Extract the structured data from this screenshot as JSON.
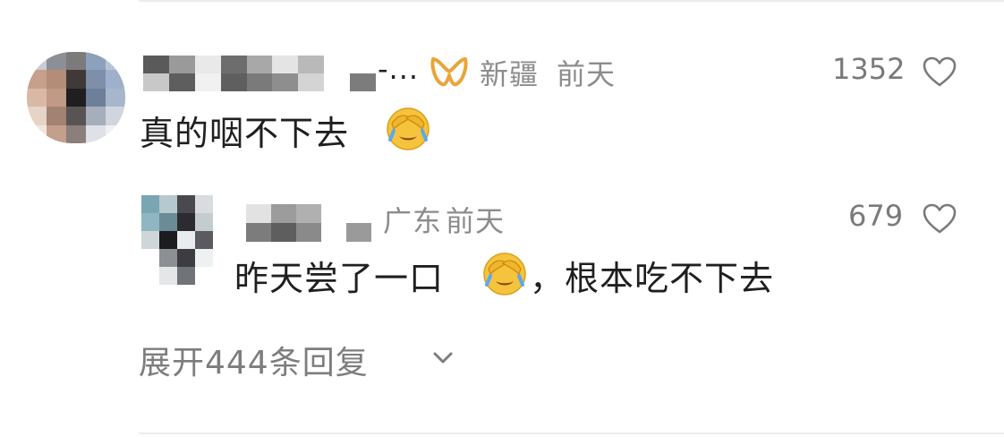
{
  "comment": {
    "truncated_name_tail": "-...",
    "location": "新疆",
    "time": "前天",
    "like_count": "1352",
    "text": "真的咽不下去"
  },
  "reply": {
    "location": "广东",
    "time": "前天",
    "like_count": "679",
    "text_before": "昨天尝了一口",
    "text_after": "，根本吃不下去"
  },
  "expand": {
    "label": "展开444条回复"
  },
  "icons": {
    "like": "heart-outline-icon",
    "badge": "orange-ribbon-badge-icon",
    "emoji": "face-palm-cry-emoji",
    "expand": "chevron-down-icon"
  },
  "colors": {
    "meta": "#8c8c8c",
    "text": "#1f1f1f",
    "badge": "#e8a63a",
    "emoji": "#f6c33c"
  }
}
